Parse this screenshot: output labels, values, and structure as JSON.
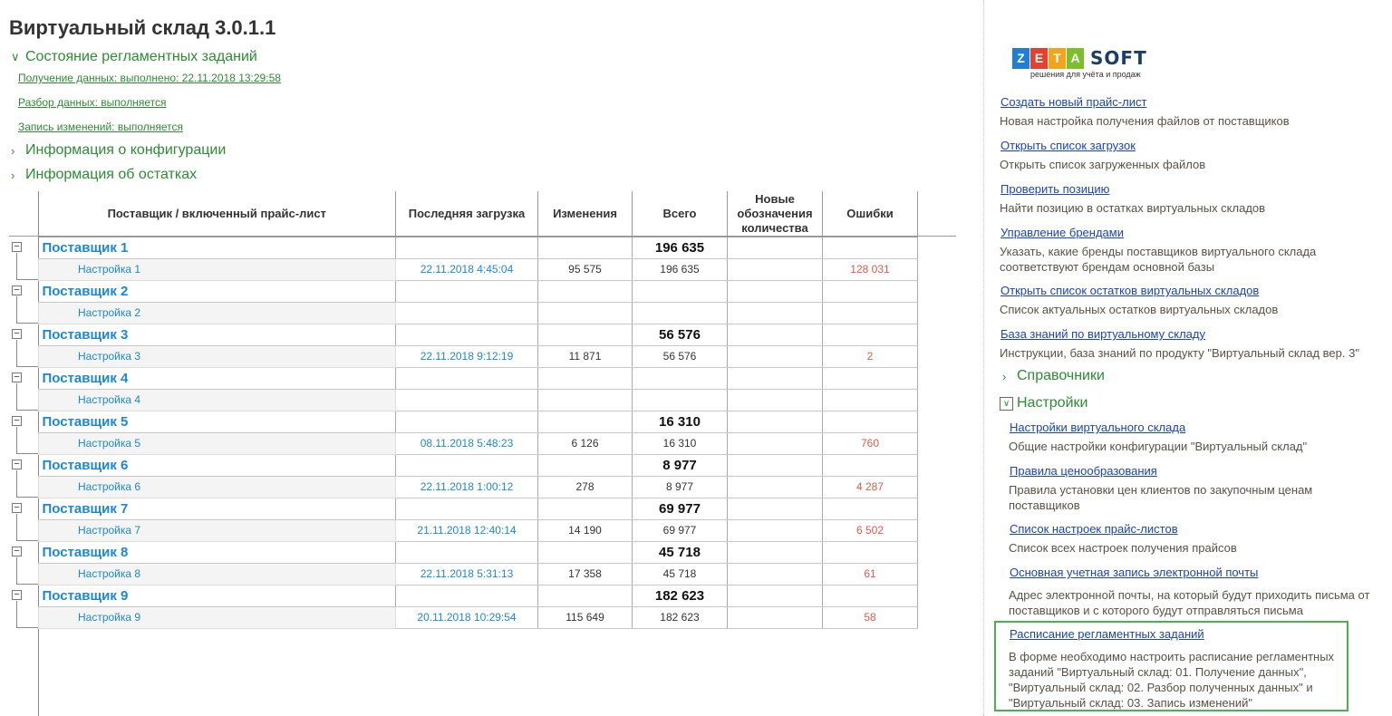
{
  "title": "Виртуальный склад 3.0.1.1",
  "status_group": {
    "label": "Состояние регламентных заданий",
    "links": [
      "Получение данных: выполнено: 22.11.2018 13:29:58",
      "Разбор данных: выполняется",
      "Запись изменений: выполняется"
    ]
  },
  "config_group": {
    "label": "Информация о конфигурации"
  },
  "stock_group": {
    "label": "Информация об остатках"
  },
  "table": {
    "headers": {
      "supplier": "Поставщик / включенный прайс-лист",
      "last_load": "Последняя загрузка",
      "changes": "Изменения",
      "total": "Всего",
      "new_quantity": "Новые обозначения количества",
      "errors": "Ошибки"
    },
    "suppliers": [
      {
        "name": "Поставщик 1",
        "total": "196 635",
        "setting": {
          "name": "Настройка 1",
          "date": "22.11.2018 4:45:04",
          "changes": "95 575",
          "total": "196 635",
          "errors": "128 031"
        }
      },
      {
        "name": "Поставщик 2",
        "total": "",
        "setting": {
          "name": "Настройка 2",
          "date": "",
          "changes": "",
          "total": "",
          "errors": ""
        }
      },
      {
        "name": "Поставщик 3",
        "total": "56 576",
        "setting": {
          "name": "Настройка 3",
          "date": "22.11.2018 9:12:19",
          "changes": "11 871",
          "total": "56 576",
          "errors": "2"
        }
      },
      {
        "name": "Поставщик 4",
        "total": "",
        "setting": {
          "name": "Настройка 4",
          "date": "",
          "changes": "",
          "total": "",
          "errors": ""
        }
      },
      {
        "name": "Поставщик 5",
        "total": "16 310",
        "setting": {
          "name": "Настройка 5",
          "date": "08.11.2018 5:48:23",
          "changes": "6 126",
          "total": "16 310",
          "errors": "760"
        }
      },
      {
        "name": "Поставщик 6",
        "total": "8 977",
        "setting": {
          "name": "Настройка 6",
          "date": "22.11.2018 1:00:12",
          "changes": "278",
          "total": "8 977",
          "errors": "4 287"
        }
      },
      {
        "name": "Поставщик 7",
        "total": "69 977",
        "setting": {
          "name": "Настройка 7",
          "date": "21.11.2018 12:40:14",
          "changes": "14 190",
          "total": "69 977",
          "errors": "6 502"
        }
      },
      {
        "name": "Поставщик 8",
        "total": "45 718",
        "setting": {
          "name": "Настройка 8",
          "date": "22.11.2018 5:31:13",
          "changes": "17 358",
          "total": "45 718",
          "errors": "61"
        }
      },
      {
        "name": "Поставщик 9",
        "total": "182 623",
        "setting": {
          "name": "Настройка 9",
          "date": "20.11.2018 10:29:54",
          "changes": "115 649",
          "total": "182 623",
          "errors": "58"
        }
      }
    ]
  },
  "logo": {
    "letters": [
      "Z",
      "E",
      "T",
      "A"
    ],
    "letter_colors": [
      "#1f7fd6",
      "#e8402f",
      "#f2a51c",
      "#7bbf2a"
    ],
    "brand": "SOFT",
    "tagline": "решения для учёта и продаж"
  },
  "right_panel": {
    "links": [
      {
        "label": "Создать новый прайс-лист",
        "desc": "Новая настройка получения файлов от поставщиков"
      },
      {
        "label": "Открыть список загрузок",
        "desc": "Открыть список загруженных файлов"
      },
      {
        "label": "Проверить позицию",
        "desc": "Найти позицию в остатках виртуальных складов"
      },
      {
        "label": "Управление брендами",
        "desc": "Указать, какие бренды поставщиков виртуального склада соответствуют брендам основной базы"
      },
      {
        "label": "Открыть список остатков виртуальных складов",
        "desc": "Список актуальных остатков виртуальных складов"
      },
      {
        "label": "База знаний по виртуальному складу",
        "desc": "Инструкции, база знаний по продукту \"Виртуальный склад вер. 3\""
      }
    ],
    "catalogs_label": "Справочники",
    "settings_label": "Настройки",
    "settings_links": [
      {
        "label": "Настройки виртуального склада",
        "desc": "Общие настройки конфигурации \"Виртуальный склад\""
      },
      {
        "label": "Правила ценообразования",
        "desc": "Правила установки цен клиентов по закупочным ценам поставщиков"
      },
      {
        "label": "Список настроек прайс-листов",
        "desc": "Список всех настроек получения прайсов"
      },
      {
        "label": "Основная учетная запись электронной почты",
        "desc": "Адрес электронной почты, на который будут приходить письма от поставщиков и с которого будут отправляться письма"
      },
      {
        "label": "Расписание регламентных заданий",
        "desc": "В форме необходимо настроить расписание регламентных заданий \"Виртуальный склад: 01. Получение данных\", \"Виртуальный склад: 02. Разбор полученных данных\" и \"Виртуальный склад: 03. Запись изменений\""
      }
    ]
  }
}
